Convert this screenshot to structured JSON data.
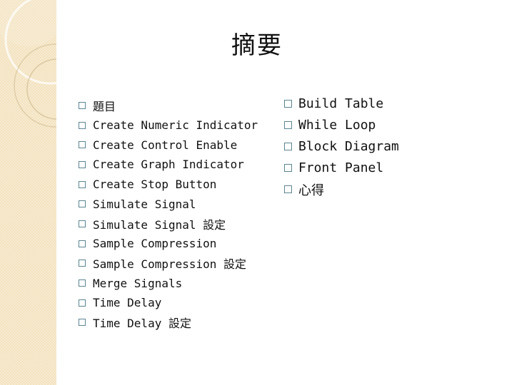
{
  "slide": {
    "title": "摘要",
    "left_items": [
      {
        "label": "題目"
      },
      {
        "label": "Create Numeric Indicator"
      },
      {
        "label": "Create Control Enable"
      },
      {
        "label": "Create Graph Indicator"
      },
      {
        "label": "Create Stop Button"
      },
      {
        "label": "Simulate Signal"
      },
      {
        "label": "Simulate Signal 設定"
      },
      {
        "label": "Sample Compression"
      },
      {
        "label": "Sample Compression 設定"
      },
      {
        "label": "Merge Signals"
      },
      {
        "label": "Time Delay"
      },
      {
        "label": "Time Delay 設定"
      }
    ],
    "right_items": [
      {
        "label": "Build Table"
      },
      {
        "label": "While Loop"
      },
      {
        "label": "Block Diagram"
      },
      {
        "label": "Front Panel"
      },
      {
        "label": "心得"
      }
    ],
    "bullet_icon": "square-bullet-icon",
    "colors": {
      "sidebar": "#f3e3c0",
      "bullet": "#5b8591",
      "text": "#111111"
    }
  }
}
